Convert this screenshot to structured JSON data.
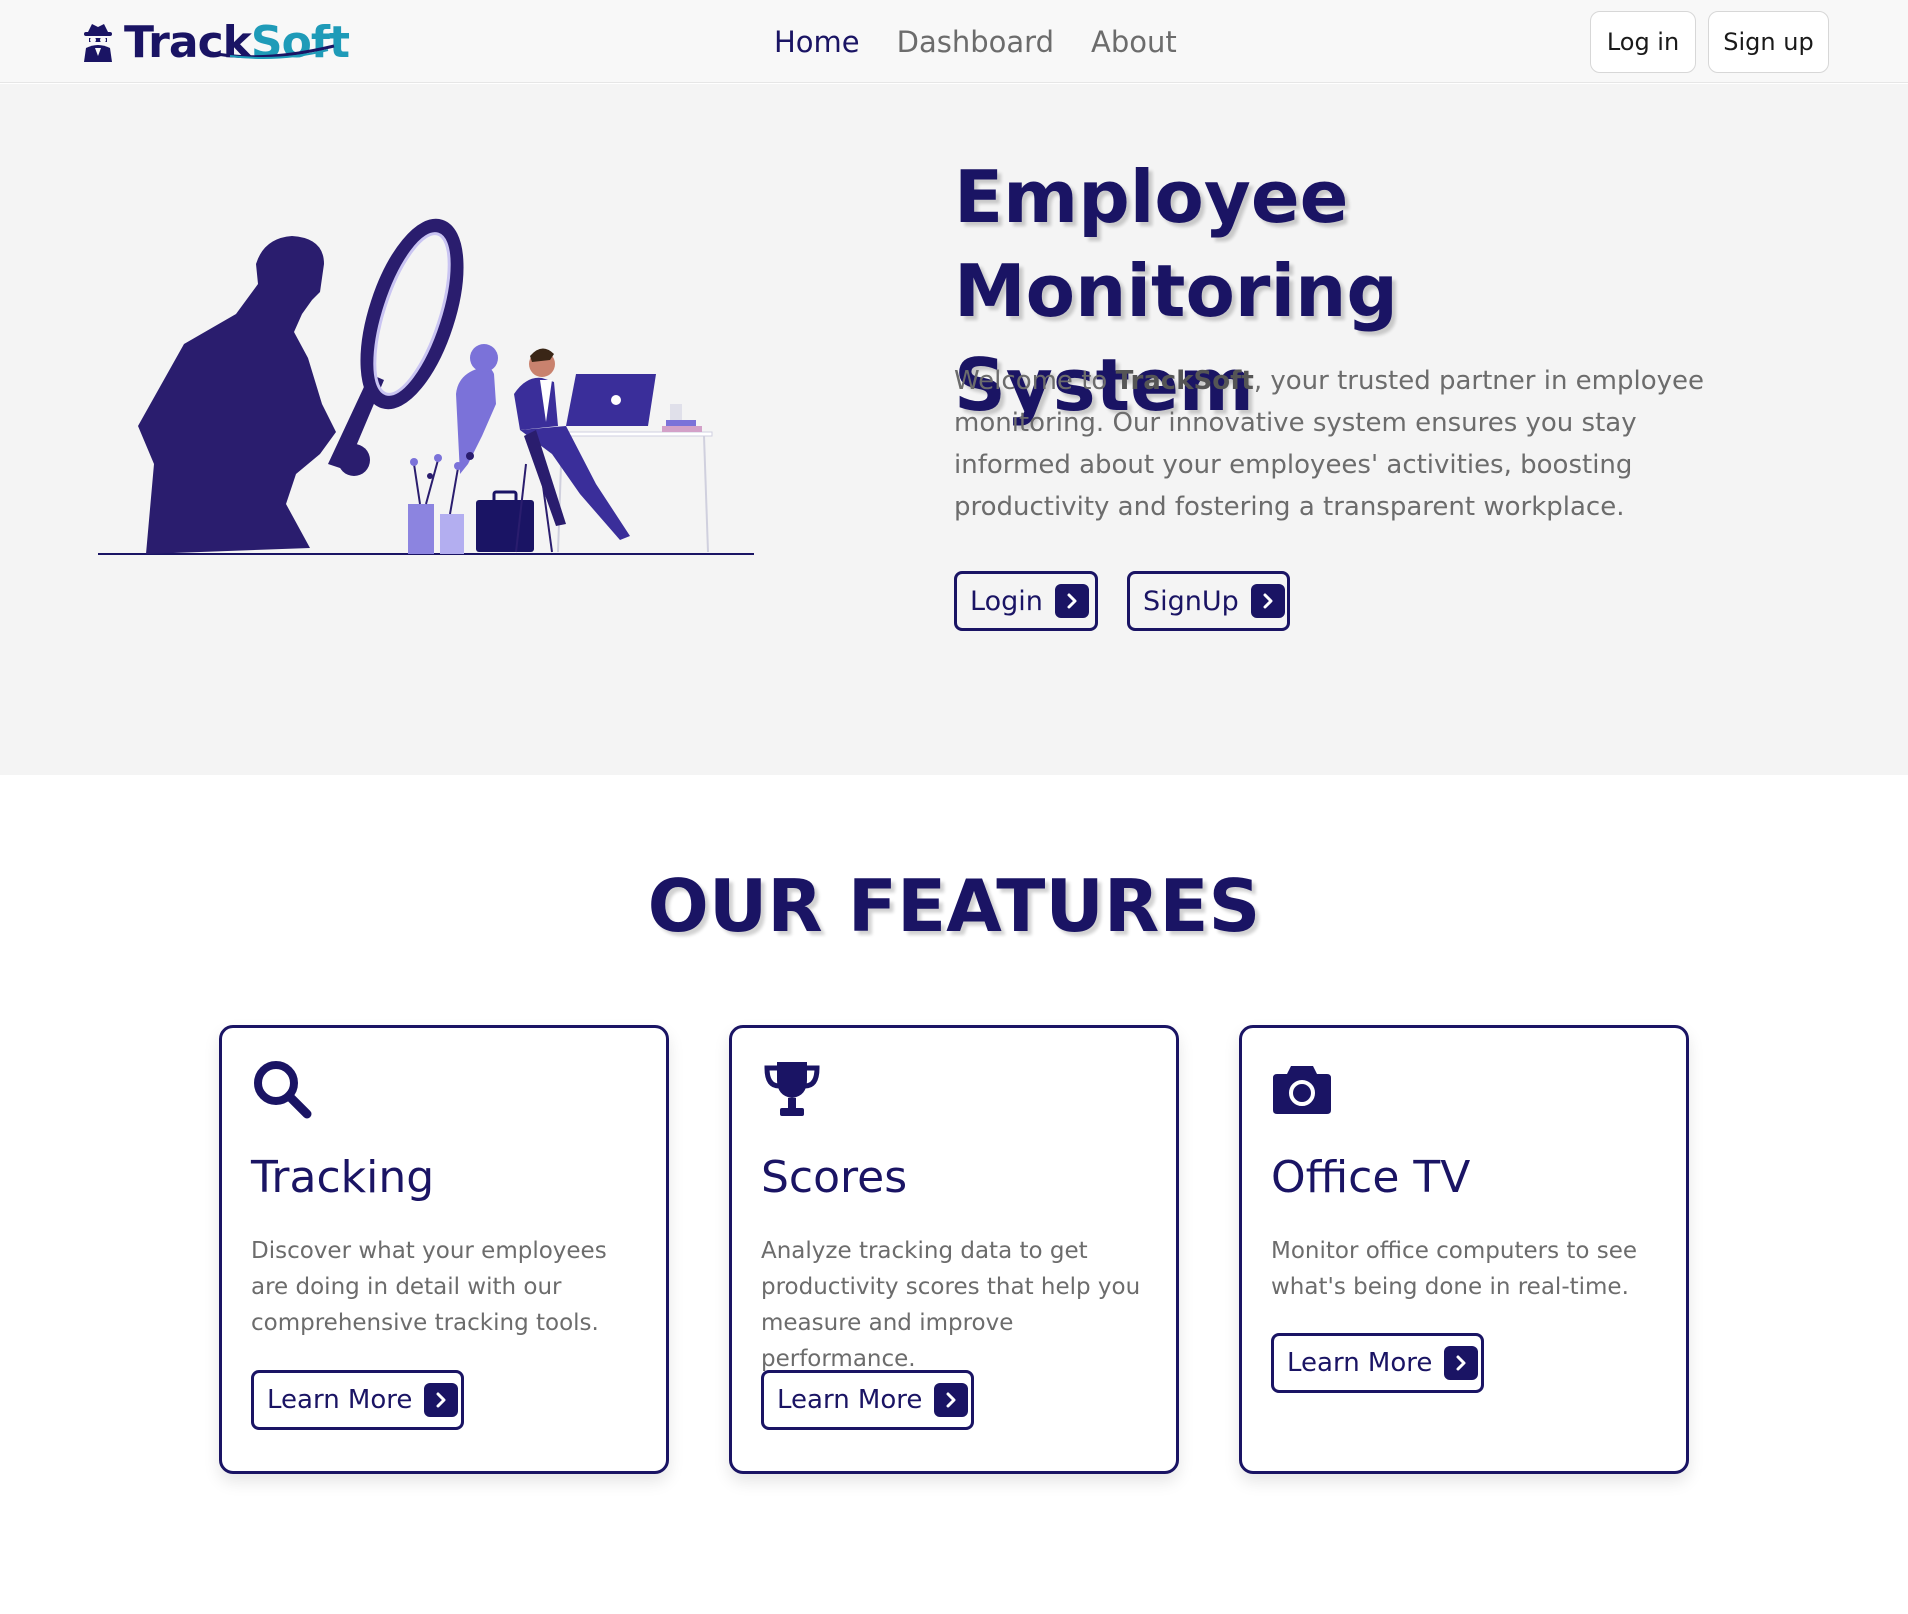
{
  "brand": {
    "part1": "Track",
    "part2": "Soft"
  },
  "nav": {
    "links": [
      "Home",
      "Dashboard",
      "About"
    ],
    "login_label": "Log in",
    "signup_label": "Sign up"
  },
  "hero": {
    "title_line1": "Employee Monitoring",
    "title_line2": "System",
    "desc_pre": "Welcome to ",
    "desc_brand": "TrackSoft",
    "desc_post": ", your trusted partner in employee monitoring. Our innovative system ensures you stay informed about your employees' activities, boosting productivity and fostering a transparent workplace.",
    "login_label": "Login",
    "signup_label": "SignUp"
  },
  "features": {
    "title": "OUR FEATURES",
    "cards": [
      {
        "icon": "magnifying-glass-icon",
        "title": "Tracking",
        "desc": "Discover what your employees are doing in detail with our comprehensive tracking tools.",
        "button": "Learn More"
      },
      {
        "icon": "trophy-icon",
        "title": "Scores",
        "desc": "Analyze tracking data to get productivity scores that help you measure and improve performance.",
        "button": "Learn More"
      },
      {
        "icon": "camera-icon",
        "title": "Office TV",
        "desc": "Monitor office computers to see what's being done in real-time.",
        "button": "Learn More"
      }
    ]
  },
  "colors": {
    "primary": "#1a1464",
    "accent": "#1f9bb8",
    "hero_bg": "#f4f4f4",
    "muted_text": "#6c6c6c",
    "illustration_light": "#7b72d9"
  }
}
